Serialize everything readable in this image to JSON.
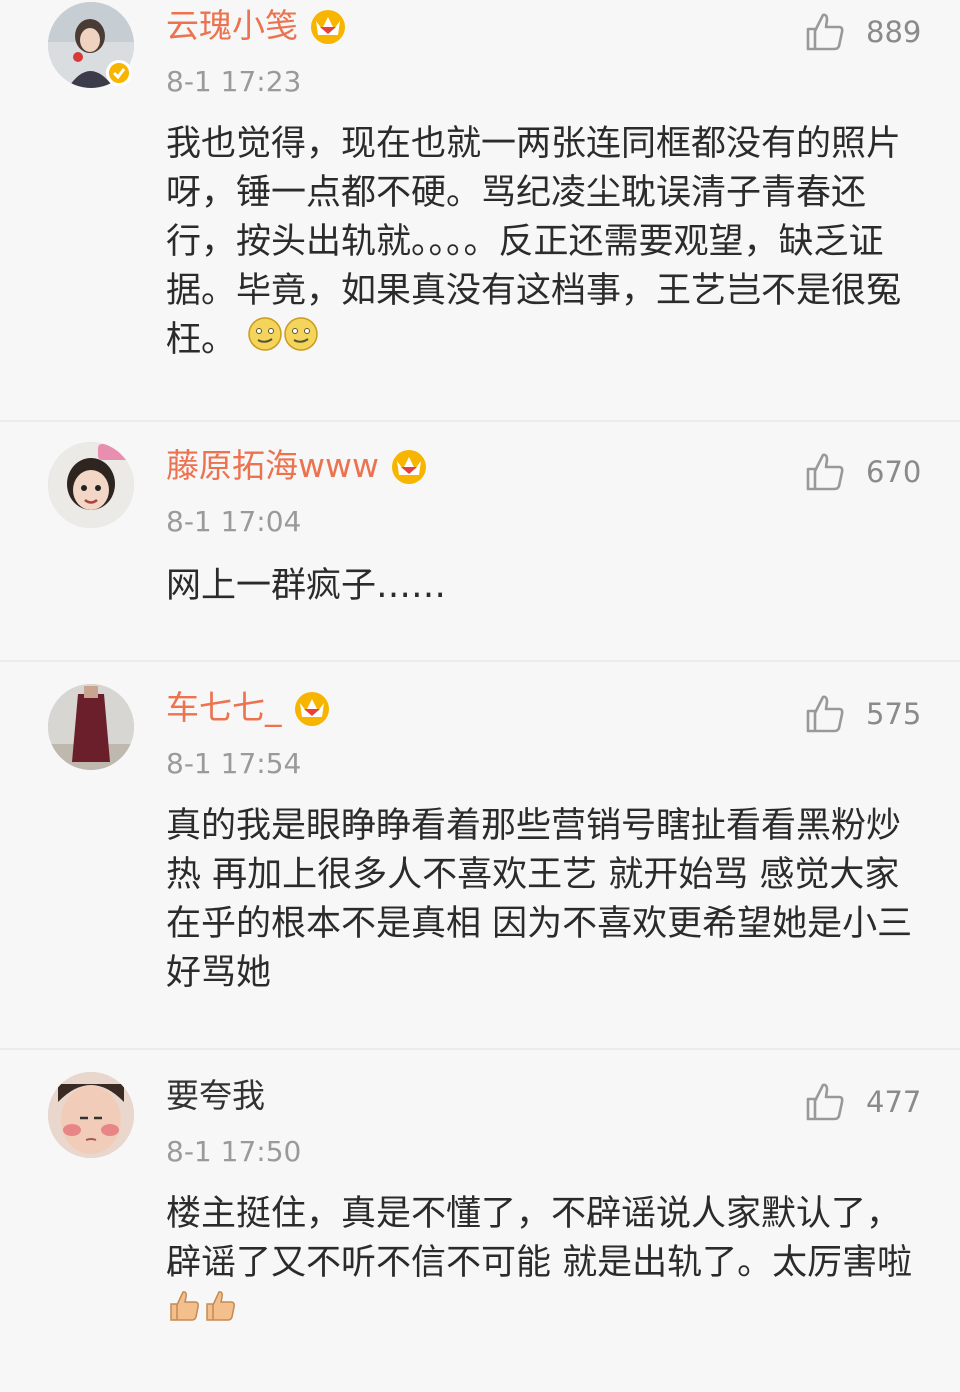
{
  "comments": [
    {
      "username": "云瑰小笺",
      "vip": true,
      "verified": true,
      "time": "8-1 17:23",
      "likes": "889",
      "text": "我也觉得，现在也就一两张连同框都没有的照片呀，锤一点都不硬。骂纪凌尘耽误清子青春还行，按头出轨就。。。。反正还需要观望，缺乏证据。毕竟，如果真没有这档事，王艺岂不是很冤枉。",
      "emojis": [
        "smile-emoji",
        "smile-emoji"
      ]
    },
    {
      "username": "藤原拓海www",
      "vip": true,
      "verified": false,
      "time": "8-1 17:04",
      "likes": "670",
      "text": "网上一群疯子……",
      "emojis": []
    },
    {
      "username": "车七七_",
      "vip": true,
      "verified": false,
      "time": "8-1 17:54",
      "likes": "575",
      "text": "真的我是眼睁睁看着那些营销号瞎扯看看黑粉炒热 再加上很多人不喜欢王艺 就开始骂 感觉大家在乎的根本不是真相 因为不喜欢更希望她是小三好骂她",
      "emojis": []
    },
    {
      "username": "要夸我",
      "vip": false,
      "verified": false,
      "time": "8-1 17:50",
      "likes": "477",
      "text": "楼主挺住，真是不懂了，不辟谣说人家默认了，辟谣了又不听不信不可能 就是出轨了。太厉害啦",
      "emojis": [
        "thumbs-up-emoji",
        "thumbs-up-emoji"
      ]
    }
  ],
  "colors": {
    "background": "#f7f7f7",
    "username_accent": "#eb7350",
    "vip_gold": "#f7b500",
    "time": "#9a9a9a",
    "text": "#2b2b2b"
  }
}
